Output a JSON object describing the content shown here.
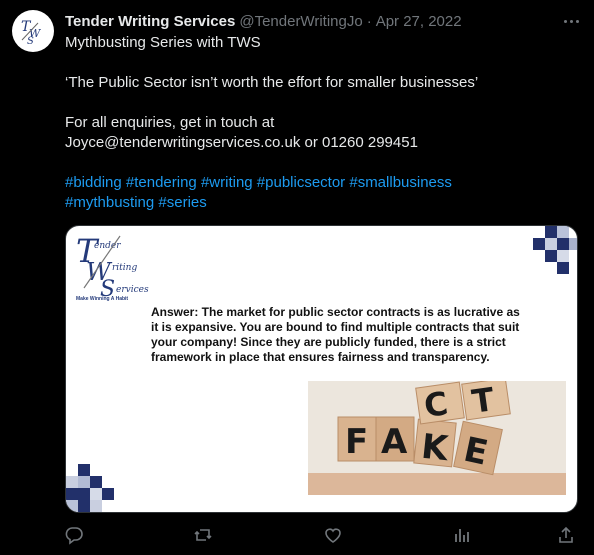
{
  "tweet": {
    "author_name": "Tender Writing Services",
    "handle": "@TenderWritingJo",
    "separator": "·",
    "date": "Apr 27, 2022",
    "lines": [
      "Mythbusting Series with TWS",
      "",
      "‘The Public Sector isn’t worth the effort for smaller businesses’",
      "",
      "For all enquiries, get in touch at",
      "Joyce@tenderwritingservices.co.uk or 01260 299451",
      ""
    ],
    "hashtags_line1": "#bidding #tendering #writing #publicsector #smallbusiness",
    "hashtags_line2": "#mythbusting #series"
  },
  "media": {
    "logo_tagline": "Make Winning A Habit",
    "answer_text": "Answer:  The market for public sector contracts is as lucrative as it is expansive. You are bound to find multiple contracts that suit your company! Since they are publicly funded, there is a strict framework in place that ensures fairness and transparency.",
    "block_letters_bottom": "FAKE",
    "block_letters_top": "CT"
  },
  "icons": {
    "avatar": "tws-logo-avatar",
    "more": "more-icon",
    "reply": "reply-icon",
    "retweet": "retweet-icon",
    "like": "heart-icon",
    "views": "analytics-icon",
    "share": "share-icon"
  },
  "colors": {
    "background": "#000000",
    "text": "#e7e9ea",
    "muted": "#71767b",
    "link": "#1d9bf0",
    "brand_navy": "#243a7a"
  }
}
